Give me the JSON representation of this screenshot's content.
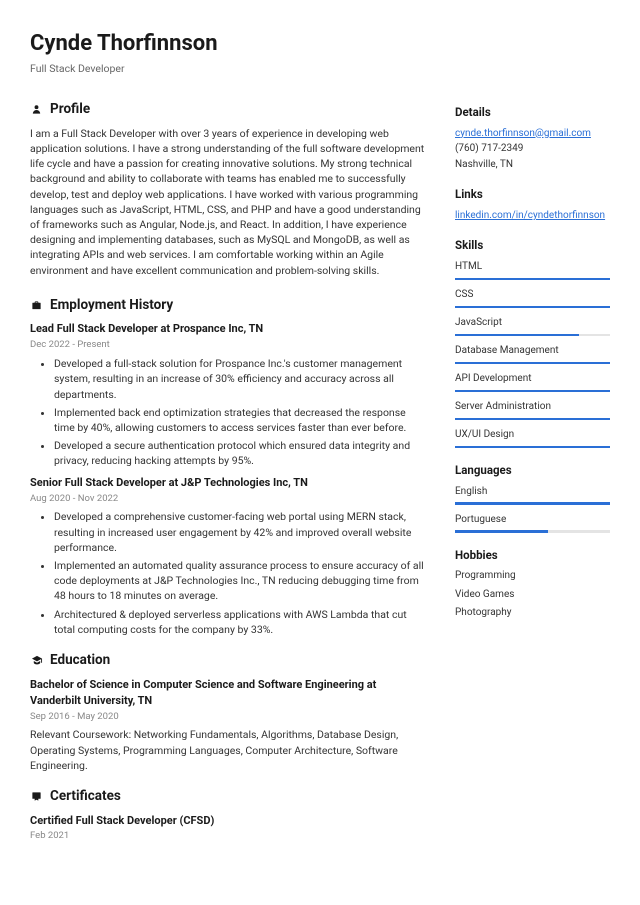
{
  "name": "Cynde Thorfinnson",
  "title": "Full Stack Developer",
  "profile": {
    "heading": "Profile",
    "text": "I am a Full Stack Developer with over 3 years of experience in developing web application solutions. I have a strong understanding of the full software development life cycle and have a passion for creating innovative solutions. My strong technical background and ability to collaborate with teams has enabled me to successfully develop, test and deploy web applications. I have worked with various programming languages such as JavaScript, HTML, CSS, and PHP and have a good understanding of frameworks such as Angular, Node.js, and React. In addition, I have experience designing and implementing databases, such as MySQL and MongoDB, as well as integrating APIs and web services. I am comfortable working within an Agile environment and have excellent communication and problem-solving skills."
  },
  "employment": {
    "heading": "Employment History",
    "jobs": [
      {
        "title": "Lead Full Stack Developer at Prospance Inc, TN",
        "dates": "Dec 2022 - Present",
        "bullets": [
          "Developed a full-stack solution for Prospance Inc.'s customer management system, resulting in an increase of 30% efficiency and accuracy across all departments.",
          "Implemented back end optimization strategies that decreased the response time by 40%, allowing customers to access services faster than ever before.",
          "Developed a secure authentication protocol which ensured data integrity and privacy, reducing hacking attempts by 95%."
        ]
      },
      {
        "title": "Senior Full Stack Developer at J&P Technologies Inc, TN",
        "dates": "Aug 2020 - Nov 2022",
        "bullets": [
          "Developed a comprehensive customer-facing web portal using MERN stack, resulting in increased user engagement by 42% and improved overall website performance.",
          "Implemented an automated quality assurance process to ensure accuracy of all code deployments at J&P Technologies Inc., TN reducing debugging time from 48 hours to 18 minutes on average.",
          "Architectured & deployed serverless applications with AWS Lambda that cut total computing costs for the company by 33%."
        ]
      }
    ]
  },
  "education": {
    "heading": "Education",
    "degree": "Bachelor of Science in Computer Science and Software Engineering at Vanderbilt University, TN",
    "dates": "Sep 2016 - May 2020",
    "desc": "Relevant Coursework: Networking Fundamentals, Algorithms, Database Design, Operating Systems, Programming Languages, Computer Architecture, Software Engineering."
  },
  "certs": {
    "heading": "Certificates",
    "title": "Certified Full Stack Developer (CFSD)",
    "dates": "Feb 2021"
  },
  "details": {
    "heading": "Details",
    "email": "cynde.thorfinnson@gmail.com",
    "phone": "(760) 717-2349",
    "location": "Nashville, TN"
  },
  "links": {
    "heading": "Links",
    "url": "linkedin.com/in/cyndethorfinnson"
  },
  "skills": {
    "heading": "Skills",
    "items": [
      {
        "name": "HTML",
        "level": 100
      },
      {
        "name": "CSS",
        "level": 100
      },
      {
        "name": "JavaScript",
        "level": 80
      },
      {
        "name": "Database Management",
        "level": 100
      },
      {
        "name": "API Development",
        "level": 100
      },
      {
        "name": "Server Administration",
        "level": 100
      },
      {
        "name": "UX/UI Design",
        "level": 100
      }
    ]
  },
  "languages": {
    "heading": "Languages",
    "items": [
      {
        "name": "English",
        "level": 100
      },
      {
        "name": "Portuguese",
        "level": 60
      }
    ]
  },
  "hobbies": {
    "heading": "Hobbies",
    "items": [
      "Programming",
      "Video Games",
      "Photography"
    ]
  }
}
